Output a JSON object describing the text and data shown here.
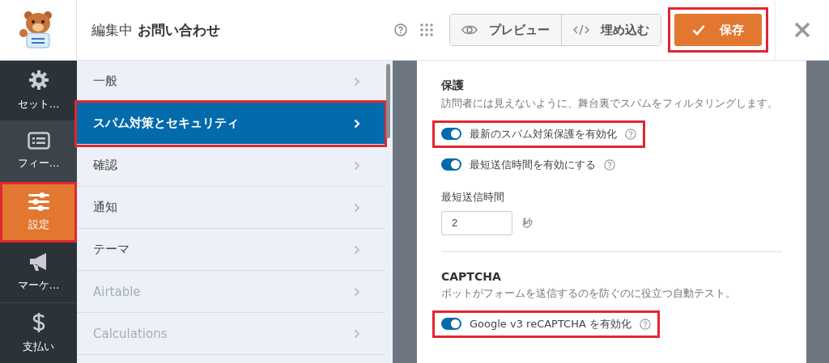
{
  "header": {
    "editing_label": "編集中",
    "form_name": "お問い合わせ",
    "preview_button": "プレビュー",
    "embed_button": "埋め込む",
    "save_button": {
      "label": "保存",
      "highlighted": true
    }
  },
  "sidebar": {
    "items": [
      {
        "label": "セット…",
        "kind": "gear",
        "selected": false,
        "highlighted": false
      },
      {
        "label": "フィー…",
        "kind": "fields",
        "selected": false,
        "highlighted": false
      },
      {
        "label": "設定",
        "kind": "sliders",
        "selected": true,
        "highlighted": true
      },
      {
        "label": "マーケ…",
        "kind": "megaphone",
        "selected": false,
        "highlighted": false
      },
      {
        "label": "支払い",
        "kind": "dollar",
        "selected": false,
        "highlighted": false
      }
    ]
  },
  "menu": {
    "items": [
      {
        "label": "一般",
        "selected": false,
        "disabled": false,
        "highlighted": false
      },
      {
        "label": "スパム対策とセキュリティ",
        "selected": true,
        "disabled": false,
        "highlighted": true
      },
      {
        "label": "確認",
        "selected": false,
        "disabled": false,
        "highlighted": false
      },
      {
        "label": "通知",
        "selected": false,
        "disabled": false,
        "highlighted": false
      },
      {
        "label": "テーマ",
        "selected": false,
        "disabled": false,
        "highlighted": false
      },
      {
        "label": "Airtable",
        "selected": false,
        "disabled": true,
        "highlighted": false
      },
      {
        "label": "Calculations",
        "selected": false,
        "disabled": true,
        "highlighted": false
      }
    ]
  },
  "sections": [
    {
      "title": "保護",
      "description": "訪問者には見えないように、舞台裏でスパムをフィルタリングします。",
      "rows": [
        {
          "kind": "toggle",
          "label": "最新のスパム対策保護を有効化",
          "on": true,
          "highlighted": true
        },
        {
          "kind": "toggle",
          "label": "最短送信時間を有効にする",
          "on": true,
          "highlighted": false
        },
        {
          "kind": "number",
          "label": "最短送信時間",
          "value": "2",
          "unit": "秒"
        }
      ]
    },
    {
      "title": "CAPTCHA",
      "description": "ボットがフォームを送信するのを防ぐのに役立つ自動テスト。",
      "rows": [
        {
          "kind": "toggle",
          "label": "Google v3 reCAPTCHA を有効化",
          "on": true,
          "highlighted": true
        }
      ]
    }
  ]
}
